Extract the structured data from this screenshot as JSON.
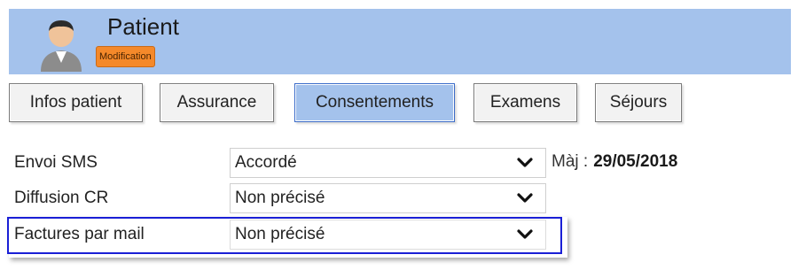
{
  "header": {
    "title": "Patient",
    "badge": "Modification",
    "accent": "#a4c2ec",
    "badge_color": "#f5892a",
    "avatar_icon": "user-avatar-icon"
  },
  "tabs": [
    {
      "label": "Infos patient",
      "active": false
    },
    {
      "label": "Assurance",
      "active": false
    },
    {
      "label": "Consentements",
      "active": true
    },
    {
      "label": "Examens",
      "active": false
    },
    {
      "label": "Séjours",
      "active": false
    }
  ],
  "form": {
    "rows": [
      {
        "label": "Envoi SMS",
        "value": "Accordé"
      },
      {
        "label": "Diffusion CR",
        "value": "Non précisé"
      },
      {
        "label": "Factures par mail",
        "value": "Non précisé"
      }
    ],
    "maj_label": "Màj :",
    "maj_date": "29/05/2018",
    "highlight_color": "#1a1fd6"
  }
}
